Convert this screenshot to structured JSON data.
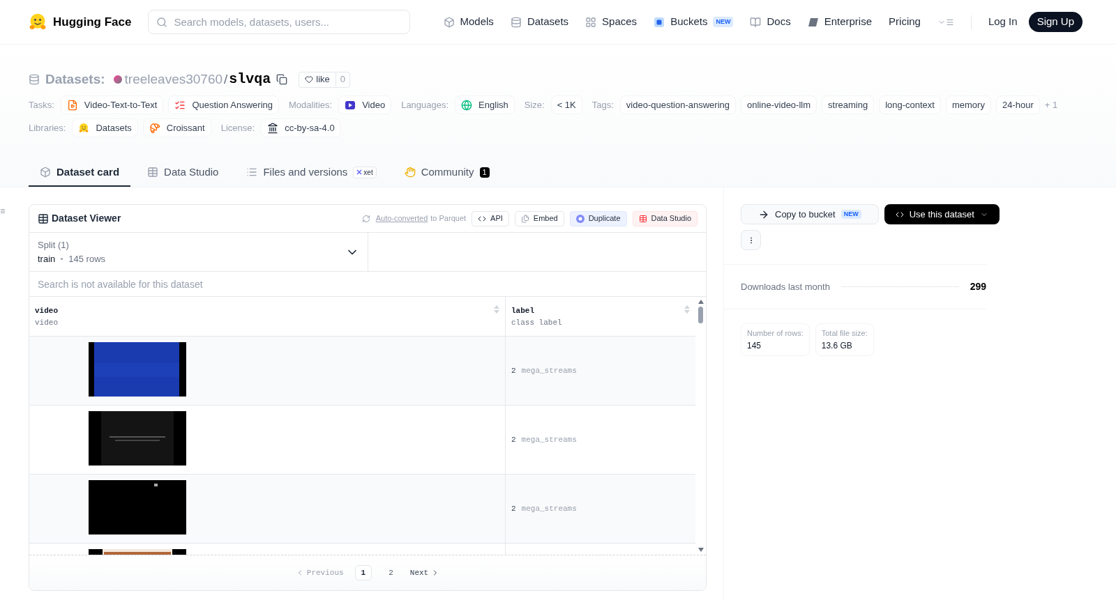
{
  "nav": {
    "brand": "Hugging Face",
    "search_placeholder": "Search models, datasets, users...",
    "items": [
      {
        "label": "Models"
      },
      {
        "label": "Datasets"
      },
      {
        "label": "Spaces"
      },
      {
        "label": "Buckets",
        "badge": "NEW"
      },
      {
        "label": "Docs"
      },
      {
        "label": "Enterprise"
      },
      {
        "label": "Pricing"
      }
    ],
    "login": "Log In",
    "signup": "Sign Up"
  },
  "repo": {
    "section": "Datasets:",
    "owner": "treeleaves30760",
    "separator": "/",
    "name": "slvqa",
    "like": "like",
    "likes": "0"
  },
  "meta_rows": [
    [
      {
        "label": "Tasks:",
        "chips": [
          "Video-Text-to-Text",
          "Question Answering"
        ]
      },
      {
        "label": "Modalities:",
        "chips": [
          "Video"
        ]
      },
      {
        "label": "Languages:",
        "chips": [
          "English"
        ]
      },
      {
        "label": "Size:",
        "chips": [
          "< 1K"
        ]
      },
      {
        "label": "Tags:",
        "chips": [
          "video-question-answering",
          "online-video-llm",
          "streaming",
          "long-context",
          "memory",
          "24-hour"
        ],
        "more": "+ 1"
      }
    ],
    [
      {
        "label": "Libraries:",
        "chips": [
          "Datasets",
          "Croissant"
        ]
      },
      {
        "label": "License:",
        "chips": [
          "cc-by-sa-4.0"
        ]
      }
    ]
  ],
  "tabs": [
    {
      "label": "Dataset card",
      "selected": true
    },
    {
      "label": "Data Studio",
      "selected": false
    },
    {
      "label": "Files and versions",
      "selected": false,
      "badge": "xet"
    },
    {
      "label": "Community",
      "selected": false,
      "count": "1"
    }
  ],
  "viewer": {
    "title": "Dataset Viewer",
    "converted_link": "Auto-converted",
    "converted_rest": "to Parquet",
    "buttons": [
      "API",
      "Embed",
      "Duplicate",
      "Data Studio"
    ],
    "split_label": "Split (1)",
    "split_value": "train",
    "split_rows": "145 rows",
    "search_placeholder": "Search is not available for this dataset",
    "columns": [
      {
        "name": "video",
        "type": "video"
      },
      {
        "name": "label",
        "type": "class label"
      }
    ],
    "rows": [
      {
        "video": {
          "kind": "picture"
        },
        "label_id": "2",
        "label_name": "mega_streams"
      },
      {
        "video": {
          "kind": "picture"
        },
        "label_id": "2",
        "label_name": "mega_streams"
      },
      {
        "video": {
          "kind": "picture"
        },
        "label_id": "2",
        "label_name": "mega_streams"
      },
      {
        "video": {
          "kind": "picture"
        }
      }
    ],
    "pagination": {
      "previous": "Previous",
      "pages": [
        {
          "label": "1",
          "selected": true
        },
        {
          "label": "2",
          "selected": false
        }
      ],
      "next": "Next"
    }
  },
  "sidebar": {
    "copy": "Copy to bucket",
    "copy_badge": "NEW",
    "use": "Use this dataset",
    "downloads_label": "Downloads last month",
    "downloads": "299",
    "stats": [
      {
        "label": "Number of rows:",
        "value": "145"
      },
      {
        "label": "Total file size:",
        "value": "13.6 GB"
      }
    ]
  }
}
